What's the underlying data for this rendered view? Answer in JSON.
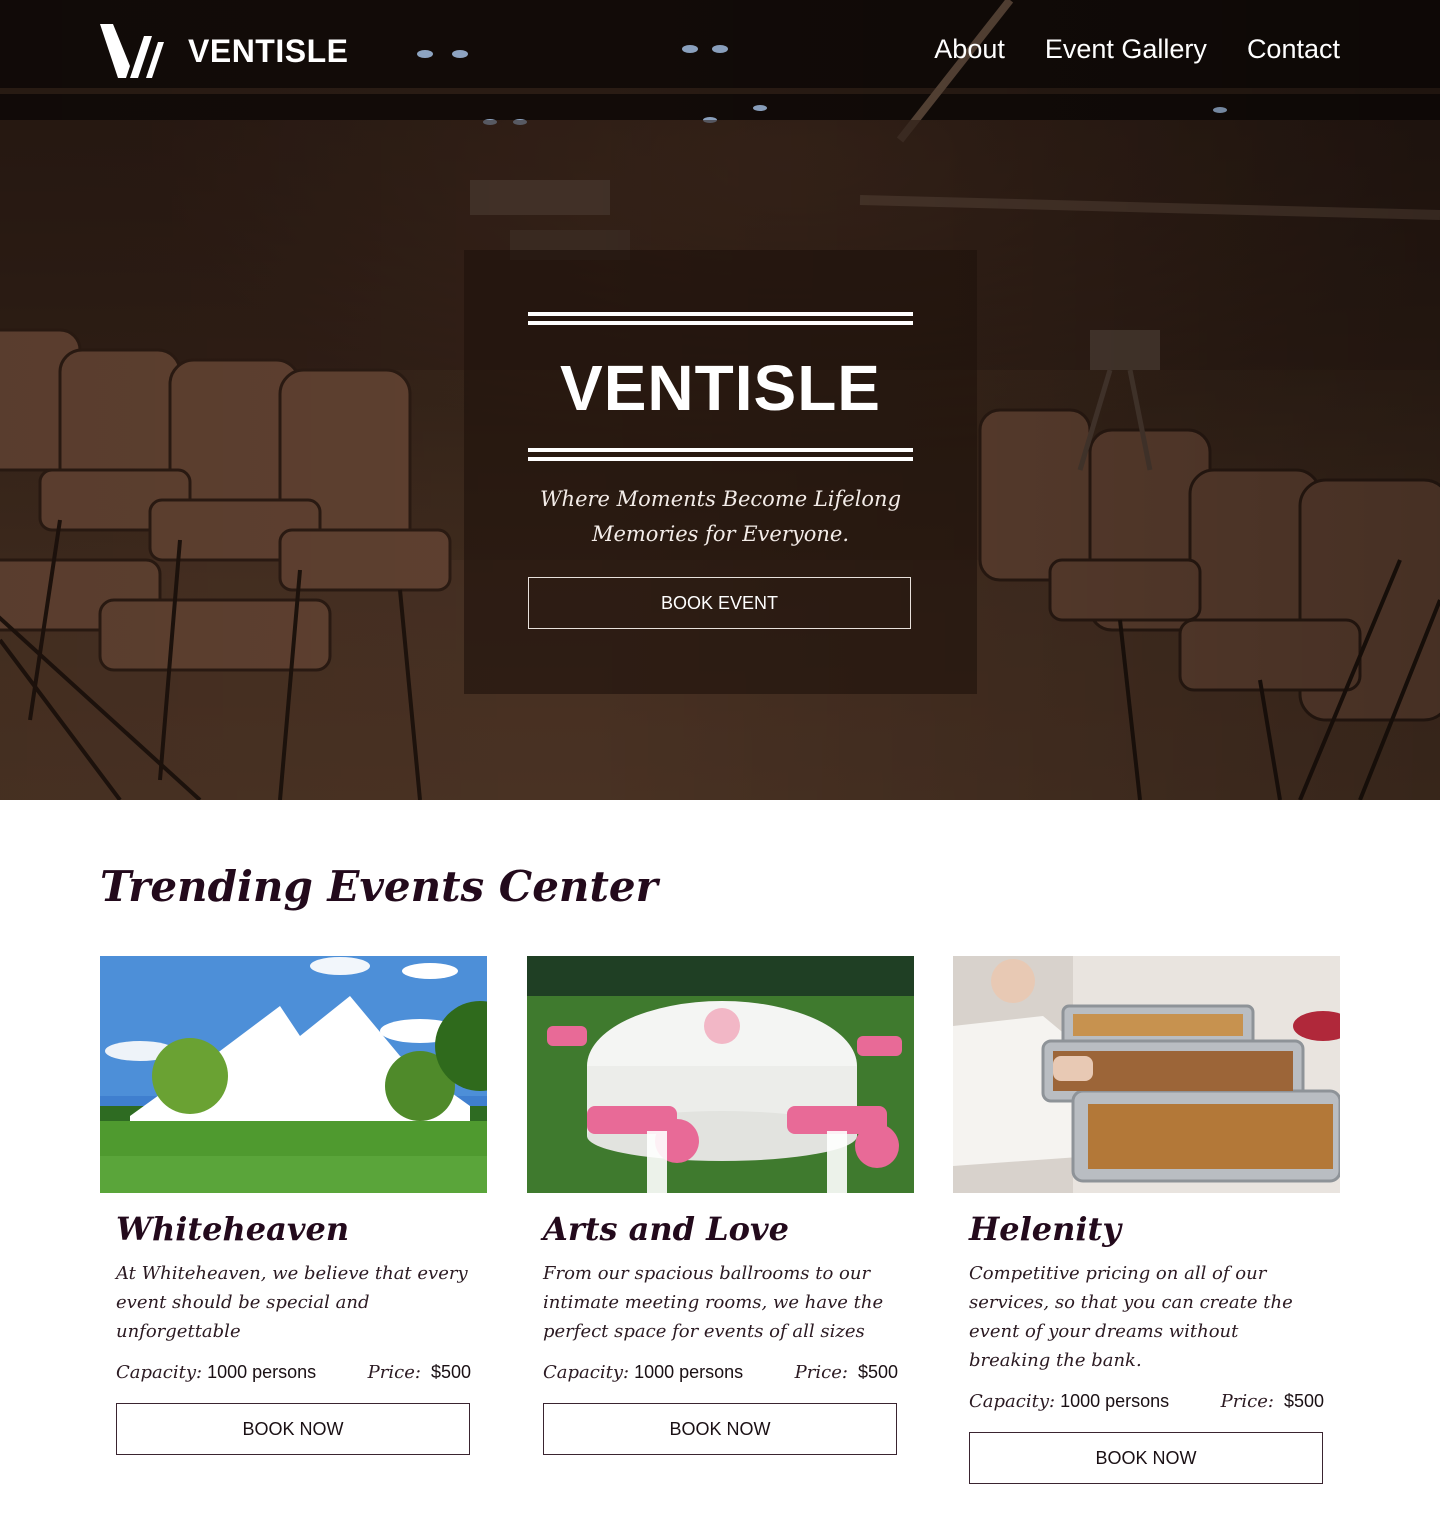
{
  "brand": {
    "name": "VENTISLE",
    "logo_icon": "v-slash-logo-icon"
  },
  "nav": {
    "items": [
      "About",
      "Event Gallery",
      "Contact"
    ]
  },
  "hero": {
    "title": "VENTISLE",
    "subtitle": "Where Moments Become Lifelong Memories for Everyone.",
    "cta": "BOOK EVENT"
  },
  "trending": {
    "title": "Trending Events Center",
    "cards": [
      {
        "name": "Whiteheaven",
        "description": "At Whiteheaven, we believe that every event should be special and unforgettable",
        "capacity_label": "Capacity:",
        "capacity_value": "1000 persons",
        "price_label": "Price:",
        "price_value": "$500",
        "button": "BOOK NOW"
      },
      {
        "name": "Arts and Love",
        "description": "From our spacious ballrooms to our intimate meeting rooms, we have the perfect space for events of all sizes",
        "capacity_label": "Capacity:",
        "capacity_value": "1000 persons",
        "price_label": "Price:",
        "price_value": "$500",
        "button": "BOOK NOW"
      },
      {
        "name": "Helenity",
        "description": "Competitive pricing on all of our services, so that you can create the event of your dreams without breaking the bank.",
        "capacity_label": "Capacity:",
        "capacity_value": "1000 persons",
        "price_label": "Price:",
        "price_value": "$500",
        "button": "BOOK NOW"
      }
    ]
  },
  "colors": {
    "heading": "#230a1c",
    "hero_overlay": "#1e120c",
    "button_border": "#3a2430",
    "white": "#ffffff"
  }
}
